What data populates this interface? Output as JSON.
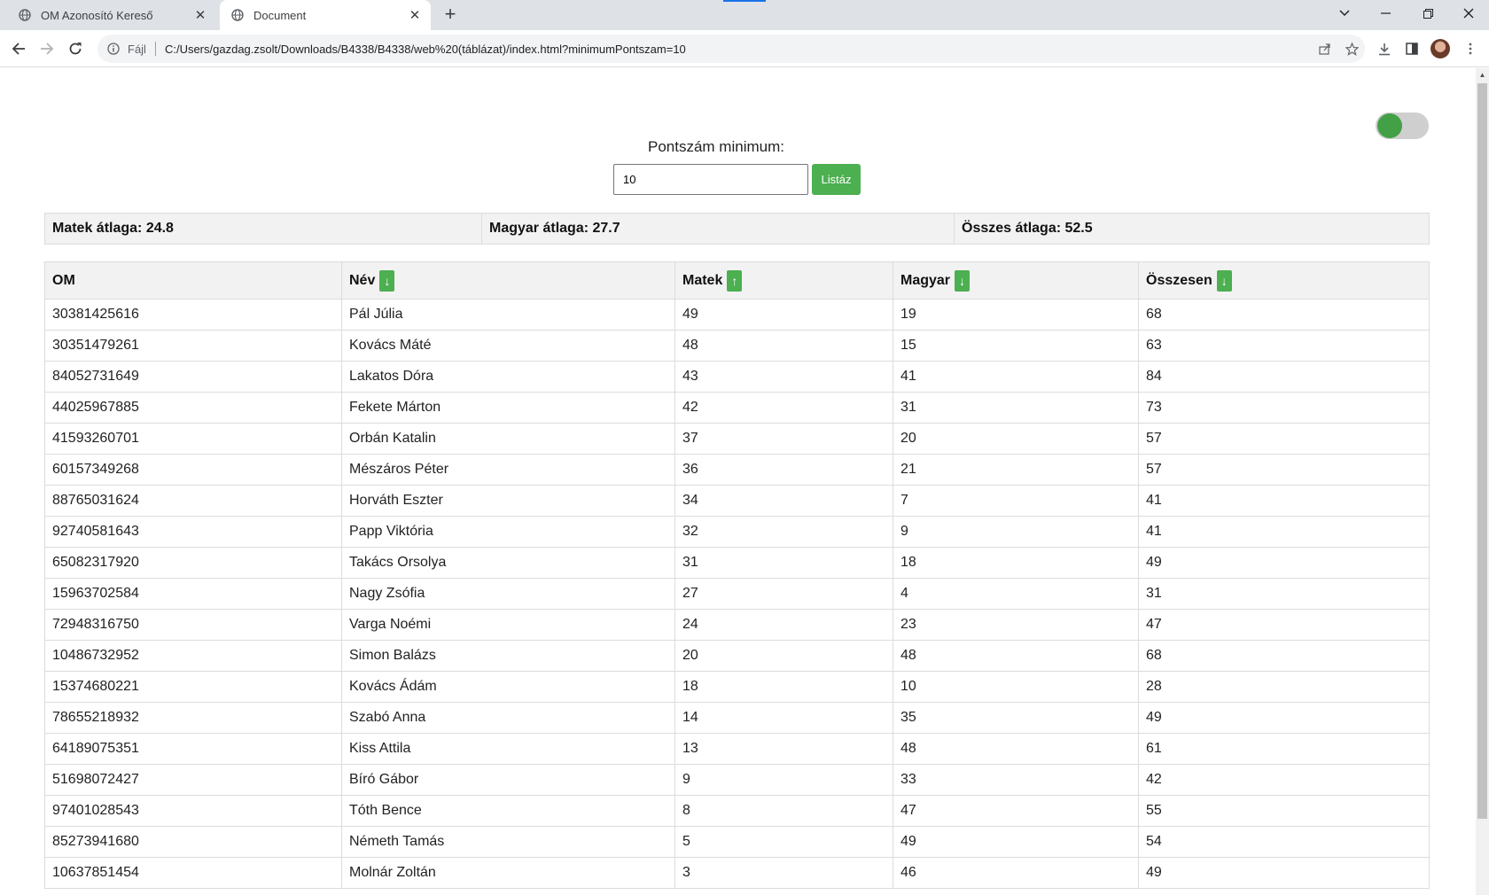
{
  "browser": {
    "tabs": [
      {
        "title": "OM Azonosító Kereső",
        "icon": "globe-icon",
        "active": false
      },
      {
        "title": "Document",
        "icon": "globe-icon",
        "active": true
      }
    ],
    "address": {
      "scheme_label": "Fájl",
      "url": "C:/Users/gazdag.zsolt/Downloads/B4338/B4338/web%20(táblázat)/index.html?minimumPontszam=10"
    }
  },
  "page": {
    "toggle_on": true,
    "filter": {
      "label": "Pontszám minimum:",
      "value": "10",
      "button_label": "Listáz"
    },
    "stats": {
      "matek": "Matek átlaga: 24.8",
      "magyar": "Magyar átlaga: 27.7",
      "osszes": "Összes átlaga: 52.5"
    },
    "table": {
      "columns": [
        {
          "label": "OM",
          "sort": ""
        },
        {
          "label": "Név",
          "sort": "↓"
        },
        {
          "label": "Matek",
          "sort": "↑"
        },
        {
          "label": "Magyar",
          "sort": "↓"
        },
        {
          "label": "Összesen",
          "sort": "↓"
        }
      ],
      "rows": [
        [
          "30381425616",
          "Pál Júlia",
          "49",
          "19",
          "68"
        ],
        [
          "30351479261",
          "Kovács Máté",
          "48",
          "15",
          "63"
        ],
        [
          "84052731649",
          "Lakatos Dóra",
          "43",
          "41",
          "84"
        ],
        [
          "44025967885",
          "Fekete Márton",
          "42",
          "31",
          "73"
        ],
        [
          "41593260701",
          "Orbán Katalin",
          "37",
          "20",
          "57"
        ],
        [
          "60157349268",
          "Mészáros Péter",
          "36",
          "21",
          "57"
        ],
        [
          "88765031624",
          "Horváth Eszter",
          "34",
          "7",
          "41"
        ],
        [
          "92740581643",
          "Papp Viktória",
          "32",
          "9",
          "41"
        ],
        [
          "65082317920",
          "Takács Orsolya",
          "31",
          "18",
          "49"
        ],
        [
          "15963702584",
          "Nagy Zsófia",
          "27",
          "4",
          "31"
        ],
        [
          "72948316750",
          "Varga Noémi",
          "24",
          "23",
          "47"
        ],
        [
          "10486732952",
          "Simon Balázs",
          "20",
          "48",
          "68"
        ],
        [
          "15374680221",
          "Kovács Ádám",
          "18",
          "10",
          "28"
        ],
        [
          "78655218932",
          "Szabó Anna",
          "14",
          "35",
          "49"
        ],
        [
          "64189075351",
          "Kiss Attila",
          "13",
          "48",
          "61"
        ],
        [
          "51698072427",
          "Bíró Gábor",
          "9",
          "33",
          "42"
        ],
        [
          "97401028543",
          "Tóth Bence",
          "8",
          "47",
          "55"
        ],
        [
          "85273941680",
          "Németh Tamás",
          "5",
          "49",
          "54"
        ],
        [
          "10637851454",
          "Molnár Zoltán",
          "3",
          "46",
          "49"
        ]
      ]
    }
  },
  "colors": {
    "accent_green": "#4caf50",
    "toggle_knob": "#43a047"
  }
}
